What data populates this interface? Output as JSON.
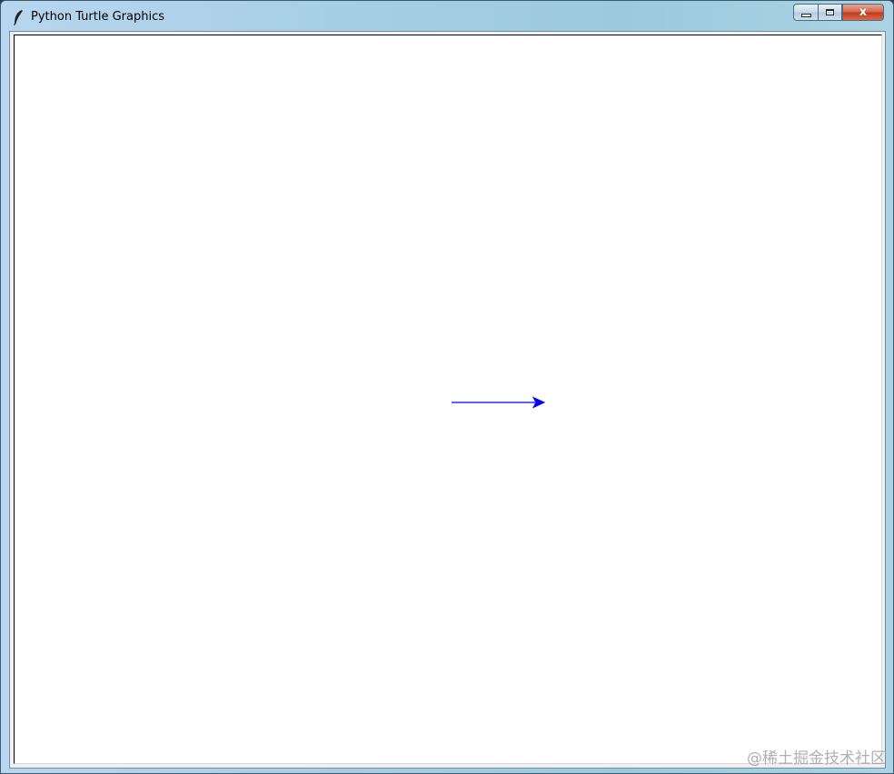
{
  "window": {
    "title": "Python Turtle Graphics",
    "app_icon": "feather-icon",
    "caption_buttons": {
      "minimize_icon": "minimize-icon",
      "maximize_icon": "maximize-icon",
      "close_icon": "close-icon",
      "close_glyph": "x"
    }
  },
  "canvas": {
    "background": "#ffffff",
    "pen_color": "#0000ff",
    "turtle_shape": "arrow-icon"
  },
  "watermark": {
    "text": "@稀土掘金技术社区"
  },
  "colors": {
    "title_bar": "#a7cfe6",
    "close_button": "#c1391a",
    "line": "#0000ff"
  }
}
